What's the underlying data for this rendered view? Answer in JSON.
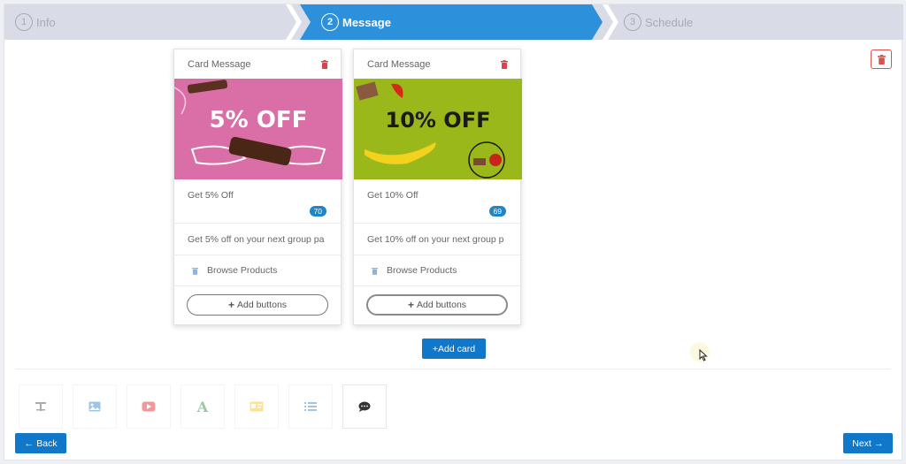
{
  "steps": [
    {
      "num": "1",
      "label": "Info"
    },
    {
      "num": "2",
      "label": "Message"
    },
    {
      "num": "3",
      "label": "Schedule"
    }
  ],
  "cards": [
    {
      "header": "Card Message",
      "image_text": "5% OFF",
      "title": "Get 5% Off",
      "count": "70",
      "description": "Get 5% off on your next group pa",
      "button_label": "Browse Products",
      "add_buttons_label": "Add buttons",
      "image_bg": "#d96fa6"
    },
    {
      "header": "Card Message",
      "image_text": "10% OFF",
      "title": "Get 10% Off",
      "count": "69",
      "description": "Get 10% off on your next group p",
      "button_label": "Browse Products",
      "add_buttons_label": "Add buttons",
      "image_bg": "#9ab81a"
    }
  ],
  "add_card_label": "+Add card",
  "tools": [
    {
      "icon": "text-icon"
    },
    {
      "icon": "image-icon"
    },
    {
      "icon": "video-icon"
    },
    {
      "icon": "font-icon"
    },
    {
      "icon": "card-icon"
    },
    {
      "icon": "list-icon"
    },
    {
      "icon": "chat-icon"
    }
  ],
  "nav": {
    "back_label": "Back",
    "next_label": "Next"
  },
  "colors": {
    "primary": "#1177c9",
    "active_step": "#2c90db",
    "danger": "#d9534f",
    "badge": "#1f84c9"
  }
}
